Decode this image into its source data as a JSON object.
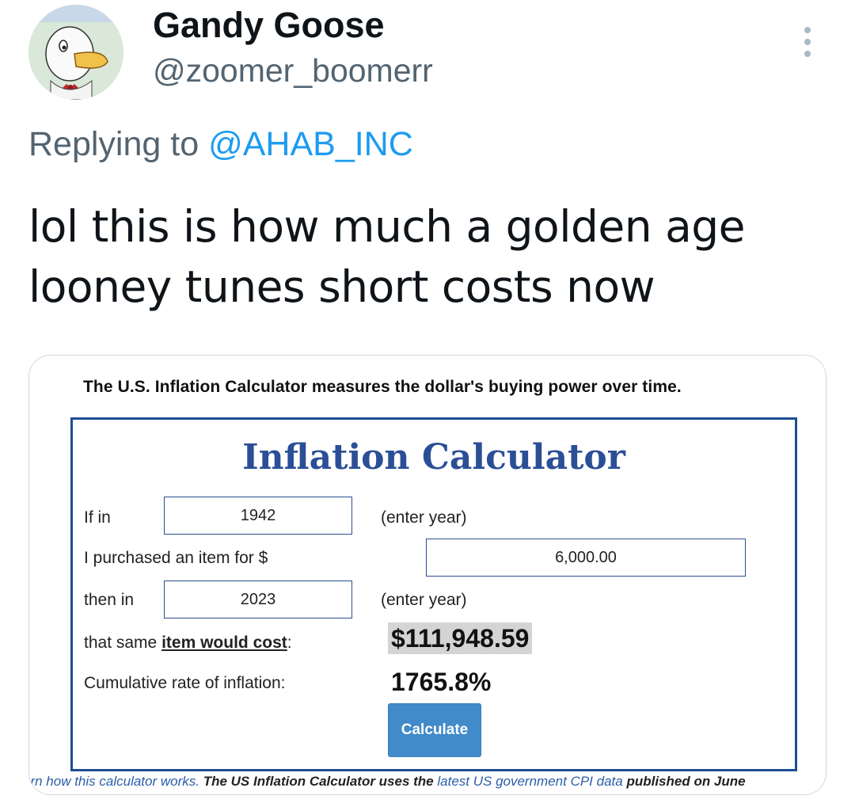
{
  "tweet": {
    "display_name": "Gandy Goose",
    "handle": "@zoomer_boomerr",
    "replying_prefix": "Replying to ",
    "replying_to": "@AHAB_INC",
    "text": "lol this is how much a golden age looney tunes short costs now",
    "more_icon": "more-vertical-icon",
    "avatar_icon": "cartoon-goose-avatar"
  },
  "calculator": {
    "caption": "The U.S. Inflation Calculator measures the dollar's buying power over time.",
    "title": "Inflation Calculator",
    "if_in_label": "If in",
    "if_in_value": "1942",
    "enter_year_1": "(enter year)",
    "purchased_label": "I purchased an item for $",
    "amount_value": "6,000.00",
    "then_in_label": "then in",
    "then_in_value": "2023",
    "enter_year_2": "(enter year)",
    "same_item_prefix": "that same ",
    "same_item_link": "item would cost",
    "same_item_suffix": ":",
    "cost_result": "$111,948.59",
    "cumulative_label": "Cumulative rate of inflation:",
    "cumulative_result": "1765.8%",
    "button_label": "Calculate",
    "footer": {
      "part1": "arn how this calculator works.",
      "part2": " The US Inflation Calculator uses the ",
      "part3": "latest US government CPI data",
      "part4": " published on June"
    }
  },
  "colors": {
    "link_blue": "#1d9bf0",
    "calc_title_blue": "#2b4f96",
    "button_blue": "#428bca",
    "secondary_text": "#536471"
  }
}
